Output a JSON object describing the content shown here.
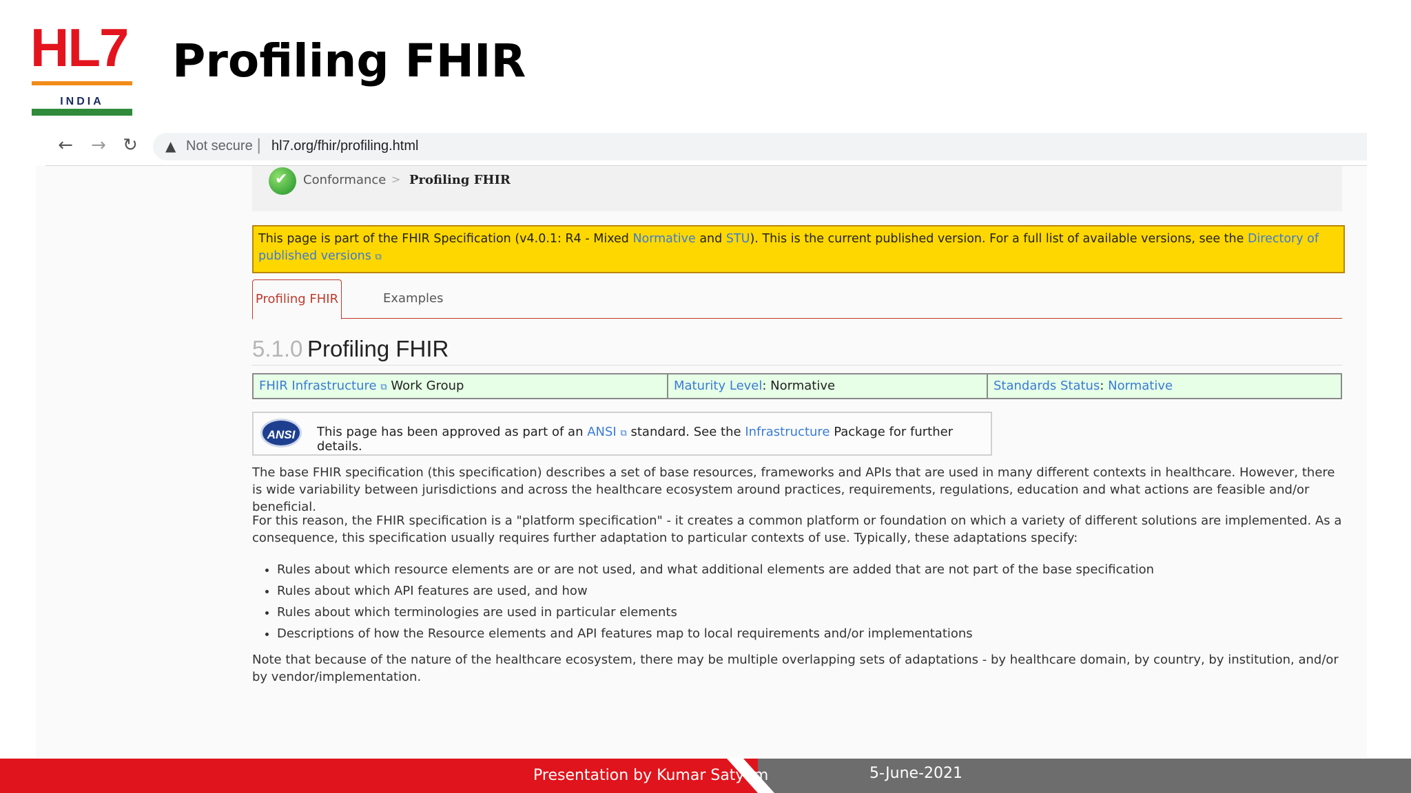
{
  "slide": {
    "logo": {
      "hl7": "HL7",
      "india": "INDIA"
    },
    "title": "Profiling FHIR",
    "footer": {
      "presenter": "Presentation by Kumar Satyam",
      "date": "5-June-2021"
    }
  },
  "browser": {
    "nav": {
      "back": "←",
      "forward": "→",
      "reload": "↻"
    },
    "security_label": "Not secure",
    "url": "hl7.org/fhir/profiling.html"
  },
  "breadcrumb": {
    "parent": "Conformance",
    "separator": ">",
    "current": "Profiling FHIR"
  },
  "notice": {
    "t1": "This page is part of the FHIR Specification (v4.0.1: R4 - Mixed ",
    "link_normative": "Normative",
    "t2": " and ",
    "link_stu": "STU",
    "t3": "). This is the current published version. For a full list of available versions, see the ",
    "link_directory": "Directory of published versions"
  },
  "tabs": [
    {
      "label": "Profiling FHIR"
    },
    {
      "label": "Examples"
    }
  ],
  "heading": {
    "number": "5.1.0",
    "title": "Profiling FHIR"
  },
  "status": {
    "wg_link": "FHIR Infrastructure",
    "wg_text": " Work Group",
    "maturity_link": "Maturity Level",
    "maturity_value": ": Normative",
    "standards_link": "Standards Status",
    "standards_sep": ": ",
    "standards_value": "Normative"
  },
  "ansi": {
    "logo_text": "ANSI",
    "t1": "This page has been approved as part of an ",
    "link_ansi": "ANSI",
    "t2": " standard. See the ",
    "link_infra": "Infrastructure",
    "t3": " Package for further details."
  },
  "content": {
    "p1": "The base FHIR specification (this specification) describes a set of base resources, frameworks and APIs that are used in many different contexts in healthcare. However, there is wide variability between jurisdictions and across the healthcare ecosystem around practices, requirements, regulations, education and what actions are feasible and/or beneficial.",
    "p2": "For this reason, the FHIR specification is a \"platform specification\" - it creates a common platform or foundation on which a variety of different solutions are implemented. As a consequence, this specification usually requires further adaptation to particular contexts of use. Typically, these adaptations specify:",
    "bullets": [
      "Rules about which resource elements are or are not used, and what additional elements are added that are not part of the base specification",
      "Rules about which API features are used, and how",
      "Rules about which terminologies are used in particular elements",
      "Descriptions of how the Resource elements and API features map to local requirements and/or implementations"
    ],
    "p3": "Note that because of the nature of the healthcare ecosystem, there may be multiple overlapping sets of adaptations - by healthcare domain, by country, by institution, and/or by vendor/implementation."
  },
  "colors": {
    "accent_red": "#e0141c",
    "notice_yellow": "#ffd700",
    "link_blue": "#3a7bd5",
    "status_green_bg": "#e6ffe6"
  },
  "icons": {
    "ext_link": "external-link-icon",
    "security": "warning-triangle-icon",
    "conformance": "green-check-icon"
  }
}
